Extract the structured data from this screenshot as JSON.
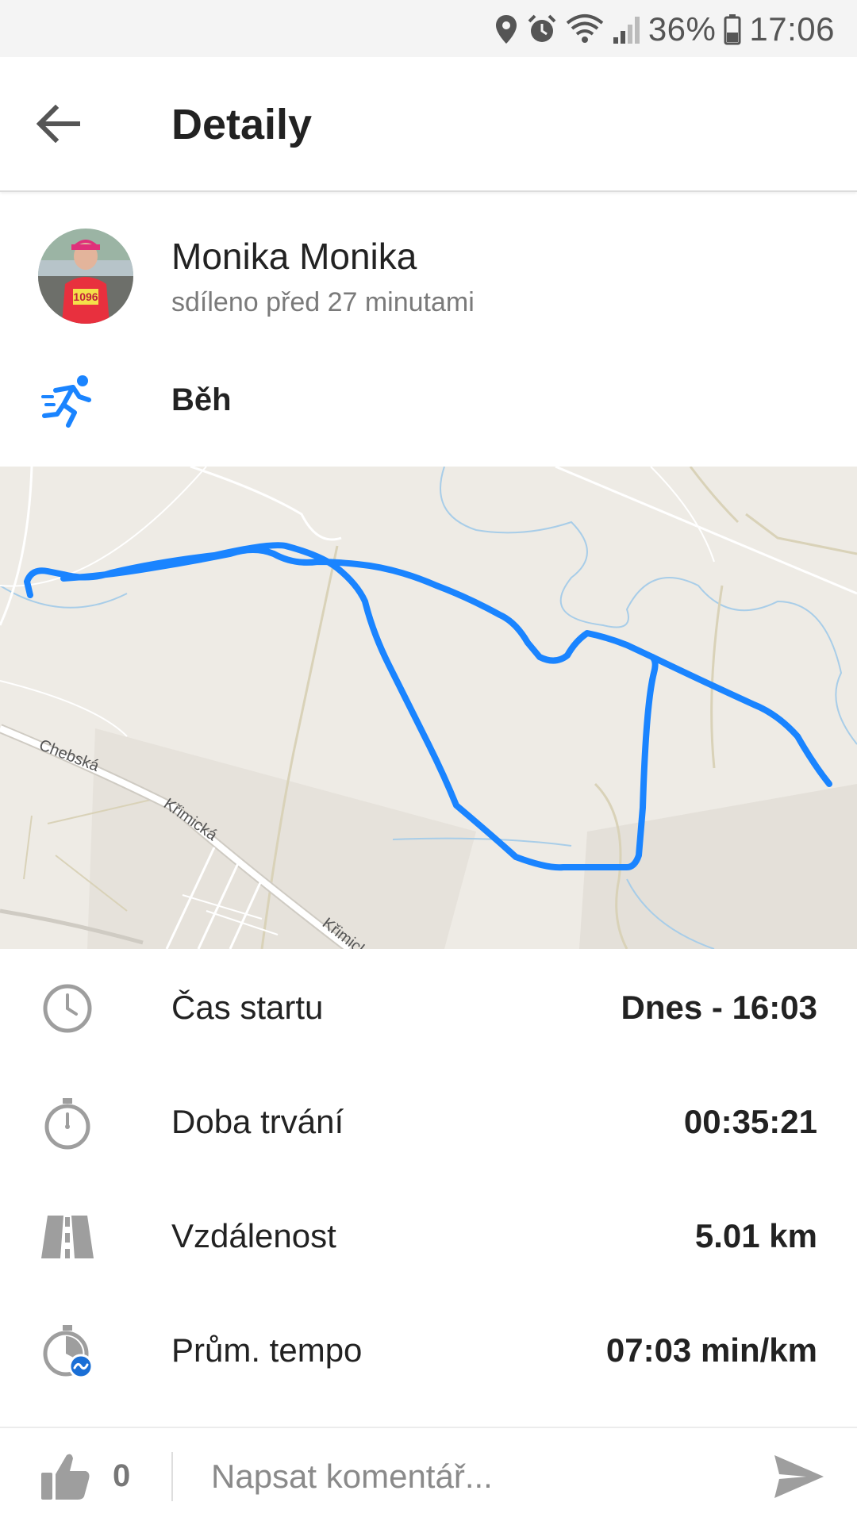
{
  "status_bar": {
    "battery": "36%",
    "time": "17:06",
    "icons": [
      "location-icon",
      "alarm-icon",
      "wifi-icon",
      "signal-icon",
      "battery-icon"
    ]
  },
  "app_bar": {
    "back_icon": "arrow-left-icon",
    "title": "Detaily"
  },
  "profile": {
    "name": "Monika Monika",
    "shared": "sdíleno před 27 minutami",
    "bib_number": "1096"
  },
  "activity": {
    "icon": "running-icon",
    "label": "Běh"
  },
  "map": {
    "street_labels": [
      "Chebská",
      "Křimická",
      "Křimick"
    ],
    "route_color": "#1a84ff"
  },
  "stats": [
    {
      "icon": "clock-icon",
      "label": "Čas startu",
      "value": "Dnes - 16:03"
    },
    {
      "icon": "stopwatch-icon",
      "label": "Doba trvání",
      "value": "00:35:21"
    },
    {
      "icon": "road-icon",
      "label": "Vzdálenost",
      "value": "5.01 km"
    },
    {
      "icon": "pace-icon",
      "label": "Prům. tempo",
      "value": "07:03 min/km"
    }
  ],
  "bottom_bar": {
    "like_icon": "thumbs-up-icon",
    "like_count": "0",
    "comment_placeholder": "Napsat komentář...",
    "send_icon": "send-icon"
  },
  "colors": {
    "accent": "#1a84ff",
    "icon_gray": "#9e9e9e",
    "map_bg": "#eeebe5"
  }
}
